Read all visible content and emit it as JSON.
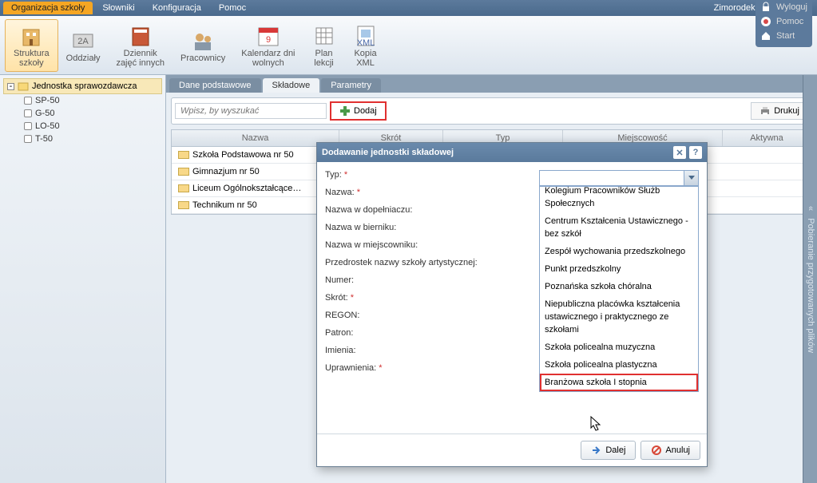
{
  "top_menu": {
    "tabs": [
      "Organizacja szkoły",
      "Słowniki",
      "Konfiguracja",
      "Pomoc"
    ],
    "user": "Zimorodek Tomasz [TZ]"
  },
  "ribbon": {
    "items": [
      {
        "label": "Struktura\nszkoły"
      },
      {
        "label": "Oddziały"
      },
      {
        "label": "Dziennik\nzajęć innych"
      },
      {
        "label": "Pracownicy"
      },
      {
        "label": "Kalendarz dni\nwolnych"
      },
      {
        "label": "Plan\nlekcji"
      },
      {
        "label": "Kopia\nXML"
      }
    ],
    "links": [
      "Wyloguj",
      "Pomoc",
      "Start"
    ]
  },
  "tree": {
    "root": "Jednostka sprawozdawcza",
    "items": [
      "SP-50",
      "G-50",
      "LO-50",
      "T-50"
    ]
  },
  "sub_tabs": [
    "Dane podstawowe",
    "Składowe",
    "Parametry"
  ],
  "toolbar": {
    "search_placeholder": "Wpisz, by wyszukać",
    "add_label": "Dodaj",
    "print_label": "Drukuj"
  },
  "grid": {
    "columns": [
      "Nazwa",
      "Skrót",
      "Typ",
      "Miejscowość",
      "Aktywna"
    ],
    "rows": [
      "Szkoła Podstawowa nr 50",
      "Gimnazjum nr 50",
      "Liceum Ogólnokształcące…",
      "Technikum nr 50"
    ]
  },
  "right_strip": "Pobieranie przygotowanych plików",
  "modal": {
    "title": "Dodawanie jednostki składowej",
    "fields": {
      "typ": "Typ:",
      "nazwa": "Nazwa:",
      "nazwa_dop": "Nazwa w dopełniaczu:",
      "nazwa_bier": "Nazwa w bierniku:",
      "nazwa_miejsc": "Nazwa w miejscowniku:",
      "przedrostek": "Przedrostek nazwy szkoły artystycznej:",
      "numer": "Numer:",
      "skrot": "Skrót:",
      "regon": "REGON:",
      "patron": "Patron:",
      "imienia": "Imienia:",
      "uprawnienia": "Uprawnienia:"
    },
    "dropdown_items": [
      "Kolegium Pracowników Służb Społecznych",
      "Centrum Kształcenia Ustawicznego - bez szkół",
      "Zespół wychowania przedszkolnego",
      "Punkt przedszkolny",
      "Poznańska szkoła chóralna",
      "Niepubliczna placówka kształcenia ustawicznego i praktycznego ze szkołami",
      "Szkoła policealna muzyczna",
      "Szkoła policealna plastyczna",
      "Branżowa szkoła I stopnia"
    ],
    "footer": {
      "next": "Dalej",
      "cancel": "Anuluj"
    }
  },
  "req_mark": "*"
}
